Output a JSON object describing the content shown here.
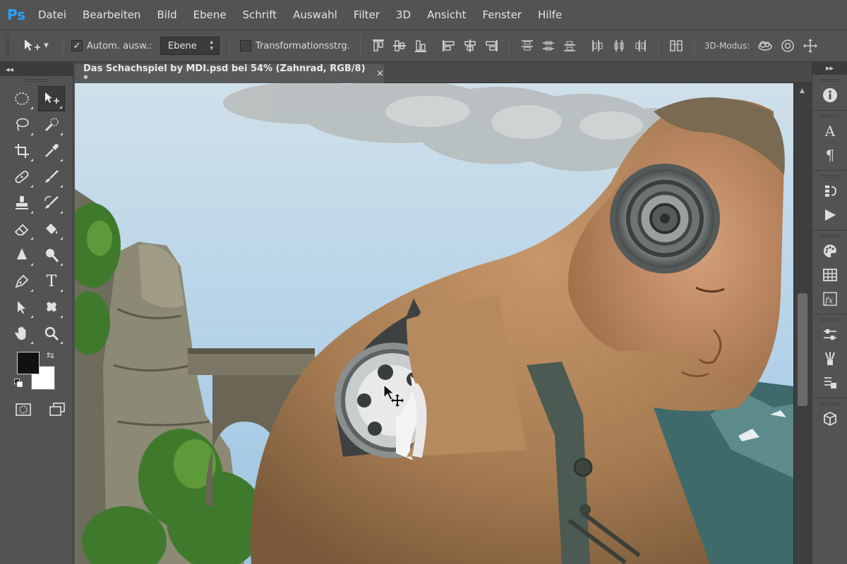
{
  "app": {
    "logo": "Ps"
  },
  "menu": [
    "Datei",
    "Bearbeiten",
    "Bild",
    "Ebene",
    "Schrift",
    "Auswahl",
    "Filter",
    "3D",
    "Ansicht",
    "Fenster",
    "Hilfe"
  ],
  "options": {
    "auto_select_label": "Autom. ausw.:",
    "auto_select_checked": true,
    "target_value": "Ebene",
    "transform_label": "Transformationsstrg.",
    "transform_checked": false,
    "mode_label": "3D-Modus:"
  },
  "document": {
    "title": "Das Schachspiel by MDI.psd bei 54% (Zahnrad, RGB/8) *",
    "close_symbol": "×"
  },
  "colors": {
    "foreground": "#111111",
    "background": "#ffffff",
    "accent": "#29a3f5"
  },
  "tools": [
    {
      "name": "elliptical-marquee-icon"
    },
    {
      "name": "move-icon",
      "active": true
    },
    {
      "name": "lasso-icon"
    },
    {
      "name": "quick-selection-icon"
    },
    {
      "name": "crop-icon"
    },
    {
      "name": "eyedropper-icon"
    },
    {
      "name": "healing-brush-icon"
    },
    {
      "name": "brush-icon"
    },
    {
      "name": "clone-stamp-icon"
    },
    {
      "name": "history-brush-icon"
    },
    {
      "name": "eraser-icon"
    },
    {
      "name": "paint-bucket-icon"
    },
    {
      "name": "blur-icon"
    },
    {
      "name": "dodge-icon"
    },
    {
      "name": "pen-icon"
    },
    {
      "name": "type-icon"
    },
    {
      "name": "path-selection-icon"
    },
    {
      "name": "custom-shape-icon"
    },
    {
      "name": "hand-icon"
    },
    {
      "name": "zoom-icon"
    }
  ],
  "type_tool_glyph": "T",
  "dock": {
    "character_glyph": "A",
    "paragraph_glyph": "¶"
  }
}
